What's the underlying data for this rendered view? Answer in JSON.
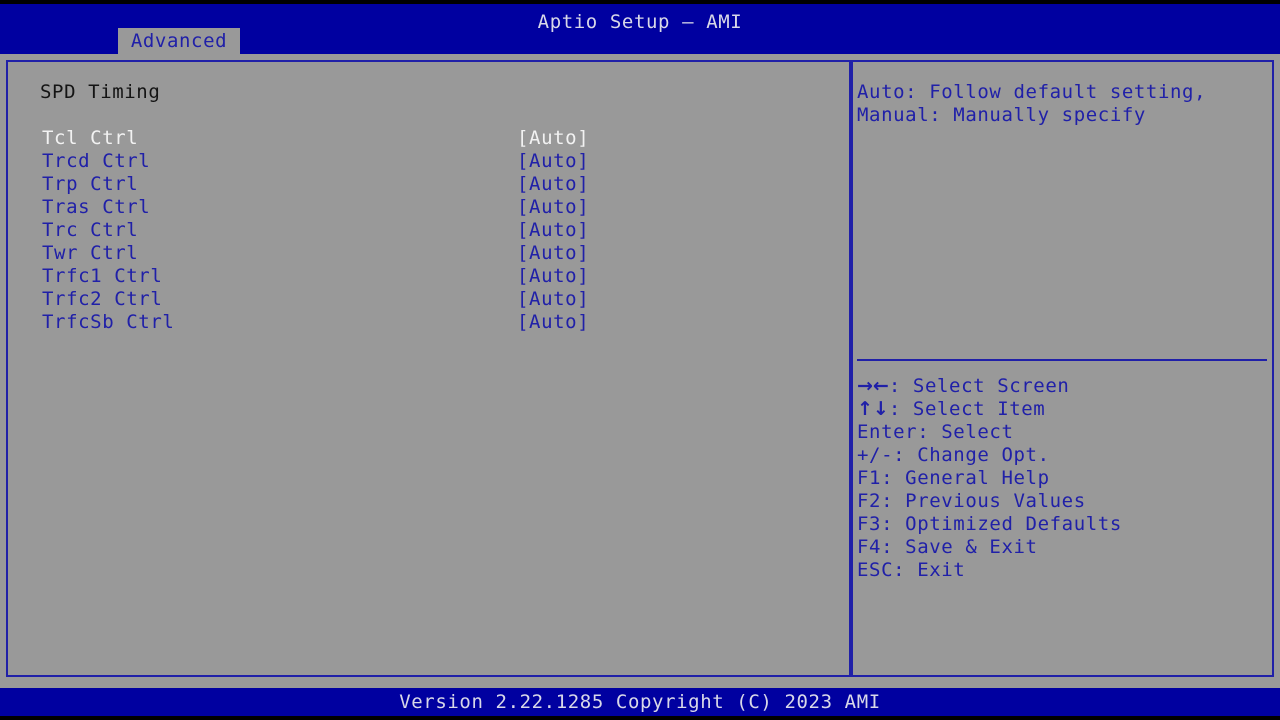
{
  "header": {
    "title": "Aptio Setup – AMI",
    "tabs": [
      {
        "label": "Advanced",
        "active": true
      }
    ]
  },
  "main": {
    "section_title": "SPD Timing",
    "options": [
      {
        "label": "Tcl Ctrl",
        "value": "[Auto]",
        "selected": true
      },
      {
        "label": "Trcd Ctrl",
        "value": "[Auto]",
        "selected": false
      },
      {
        "label": "Trp Ctrl",
        "value": "[Auto]",
        "selected": false
      },
      {
        "label": "Tras Ctrl",
        "value": "[Auto]",
        "selected": false
      },
      {
        "label": "Trc Ctrl",
        "value": "[Auto]",
        "selected": false
      },
      {
        "label": "Twr Ctrl",
        "value": "[Auto]",
        "selected": false
      },
      {
        "label": "Trfc1 Ctrl",
        "value": "[Auto]",
        "selected": false
      },
      {
        "label": "Trfc2 Ctrl",
        "value": "[Auto]",
        "selected": false
      },
      {
        "label": "TrfcSb Ctrl",
        "value": "[Auto]",
        "selected": false
      }
    ]
  },
  "help": {
    "lines": [
      "Auto: Follow default setting,",
      "Manual: Manually specify"
    ]
  },
  "legend": {
    "items": [
      {
        "keys": "→←",
        "text": ": Select Screen"
      },
      {
        "keys": "↑↓",
        "text": ": Select Item"
      },
      {
        "keys": "",
        "text": "Enter: Select"
      },
      {
        "keys": "",
        "text": "+/-: Change Opt."
      },
      {
        "keys": "",
        "text": "F1: General Help"
      },
      {
        "keys": "",
        "text": "F2: Previous Values"
      },
      {
        "keys": "",
        "text": "F3: Optimized Defaults"
      },
      {
        "keys": "",
        "text": "F4: Save & Exit"
      },
      {
        "keys": "",
        "text": "ESC: Exit"
      }
    ]
  },
  "footer": {
    "version": "Version 2.22.1285 Copyright (C) 2023 AMI"
  },
  "colors": {
    "background": "#999999",
    "bar_blue": "#0000a0",
    "text_blue": "#2020a8",
    "text_selected": "#f2f2f2",
    "text_header": "#d8d8e8",
    "text_section": "#141414"
  }
}
